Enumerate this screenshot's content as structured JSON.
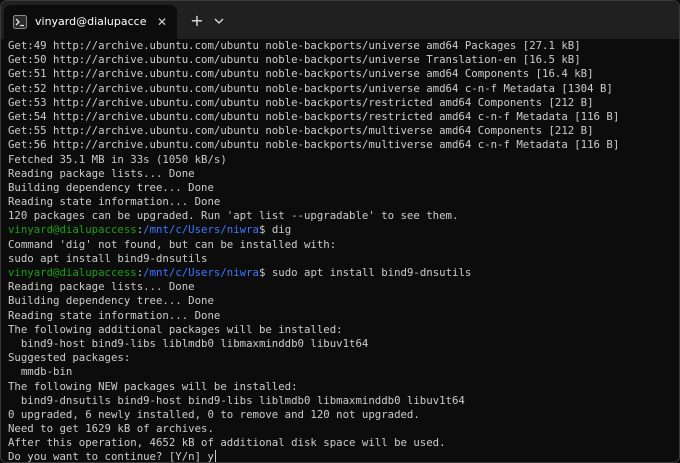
{
  "window": {
    "tab": {
      "title": "vinyard@dialupaccess: /mnt/c",
      "icon": "linux-terminal-icon",
      "close_glyph": "✕"
    },
    "new_tab_glyph": "+",
    "dropdown_icon": "chevron-down-icon"
  },
  "colors": {
    "background": "#0c0c0c",
    "text": "#cccccc",
    "prompt_user": "#13a10e",
    "prompt_path": "#3b78ff",
    "titlebar": "#202020"
  },
  "terminal": {
    "lines": [
      {
        "type": "output",
        "text": "Get:49 http://archive.ubuntu.com/ubuntu noble-backports/universe amd64 Packages [27.1 kB]"
      },
      {
        "type": "output",
        "text": "Get:50 http://archive.ubuntu.com/ubuntu noble-backports/universe Translation-en [16.5 kB]"
      },
      {
        "type": "output",
        "text": "Get:51 http://archive.ubuntu.com/ubuntu noble-backports/universe amd64 Components [16.4 kB]"
      },
      {
        "type": "output",
        "text": "Get:52 http://archive.ubuntu.com/ubuntu noble-backports/universe amd64 c-n-f Metadata [1304 B]"
      },
      {
        "type": "output",
        "text": "Get:53 http://archive.ubuntu.com/ubuntu noble-backports/restricted amd64 Components [212 B]"
      },
      {
        "type": "output",
        "text": "Get:54 http://archive.ubuntu.com/ubuntu noble-backports/restricted amd64 c-n-f Metadata [116 B]"
      },
      {
        "type": "output",
        "text": "Get:55 http://archive.ubuntu.com/ubuntu noble-backports/multiverse amd64 Components [212 B]"
      },
      {
        "type": "output",
        "text": "Get:56 http://archive.ubuntu.com/ubuntu noble-backports/multiverse amd64 c-n-f Metadata [116 B]"
      },
      {
        "type": "output",
        "text": "Fetched 35.1 MB in 33s (1050 kB/s)"
      },
      {
        "type": "output",
        "text": "Reading package lists... Done"
      },
      {
        "type": "output",
        "text": "Building dependency tree... Done"
      },
      {
        "type": "output",
        "text": "Reading state information... Done"
      },
      {
        "type": "output",
        "text": "120 packages can be upgraded. Run 'apt list --upgradable' to see them."
      },
      {
        "type": "prompt",
        "user": "vinyard@dialupaccess",
        "sep": ":",
        "path": "/mnt/c/Users/niwra",
        "symbol": "$ ",
        "command": "dig"
      },
      {
        "type": "output",
        "text": "Command 'dig' not found, but can be installed with:"
      },
      {
        "type": "output",
        "text": "sudo apt install bind9-dnsutils"
      },
      {
        "type": "prompt",
        "user": "vinyard@dialupaccess",
        "sep": ":",
        "path": "/mnt/c/Users/niwra",
        "symbol": "$ ",
        "command": "sudo apt install bind9-dnsutils"
      },
      {
        "type": "output",
        "text": "Reading package lists... Done"
      },
      {
        "type": "output",
        "text": "Building dependency tree... Done"
      },
      {
        "type": "output",
        "text": "Reading state information... Done"
      },
      {
        "type": "output",
        "text": "The following additional packages will be installed:"
      },
      {
        "type": "output",
        "text": "  bind9-host bind9-libs liblmdb0 libmaxminddb0 libuv1t64"
      },
      {
        "type": "output",
        "text": "Suggested packages:"
      },
      {
        "type": "output",
        "text": "  mmdb-bin"
      },
      {
        "type": "output",
        "text": "The following NEW packages will be installed:"
      },
      {
        "type": "output",
        "text": "  bind9-dnsutils bind9-host bind9-libs liblmdb0 libmaxminddb0 libuv1t64"
      },
      {
        "type": "output",
        "text": "0 upgraded, 6 newly installed, 0 to remove and 120 not upgraded."
      },
      {
        "type": "output",
        "text": "Need to get 1629 kB of archives."
      },
      {
        "type": "output",
        "text": "After this operation, 4652 kB of additional disk space will be used."
      },
      {
        "type": "input",
        "text": "Do you want to continue? [Y/n] y"
      }
    ]
  }
}
